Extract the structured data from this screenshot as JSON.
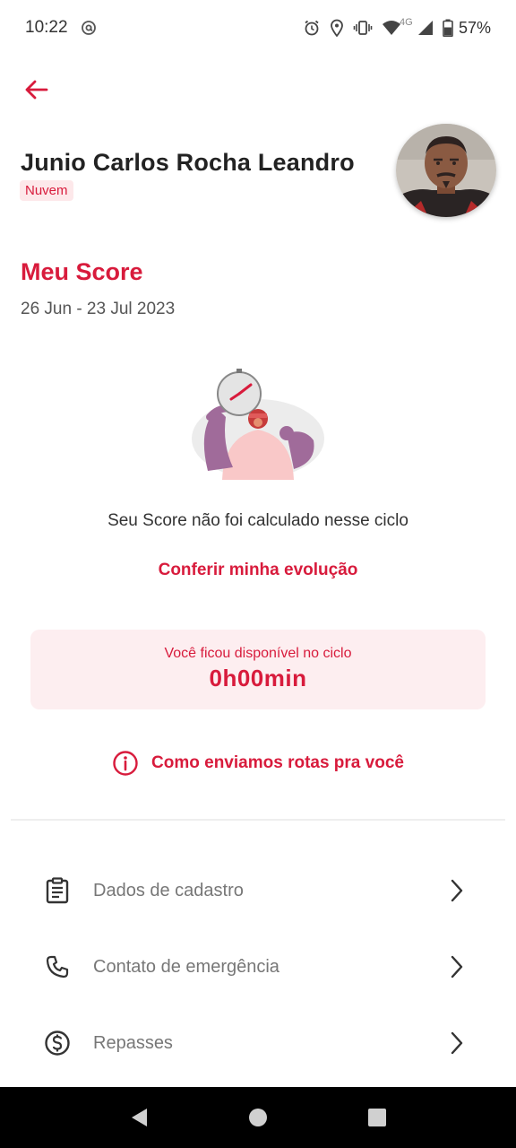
{
  "status_bar": {
    "time": "10:22",
    "network_label": "4G",
    "battery_percent": "57%",
    "icons": [
      "at-sign-icon",
      "alarm-icon",
      "location-icon",
      "vibrate-icon",
      "wifi-icon",
      "signal-icon",
      "battery-icon"
    ]
  },
  "header": {
    "back_icon": "arrow-left-icon"
  },
  "profile": {
    "name": "Junio Carlos Rocha Leandro",
    "badge": "Nuvem"
  },
  "score": {
    "title": "Meu Score",
    "dates": "26 Jun - 23 Jul 2023",
    "message": "Seu Score não foi calculado nesse ciclo",
    "evolution_link": "Conferir minha evolução"
  },
  "availability": {
    "label": "Você ficou disponível no ciclo",
    "value": "0h00min"
  },
  "routes_link": {
    "label": "Como enviamos rotas pra você",
    "icon": "info-icon"
  },
  "menu": {
    "items": [
      {
        "label": "Dados de cadastro",
        "icon": "clipboard-icon"
      },
      {
        "label": "Contato de emergência",
        "icon": "phone-icon"
      },
      {
        "label": "Repasses",
        "icon": "dollar-circle-icon"
      }
    ]
  },
  "colors": {
    "accent": "#d81b3c",
    "card_background": "#fdeef0",
    "badge_background": "#fde8ea",
    "nav_bar": "#000000"
  }
}
